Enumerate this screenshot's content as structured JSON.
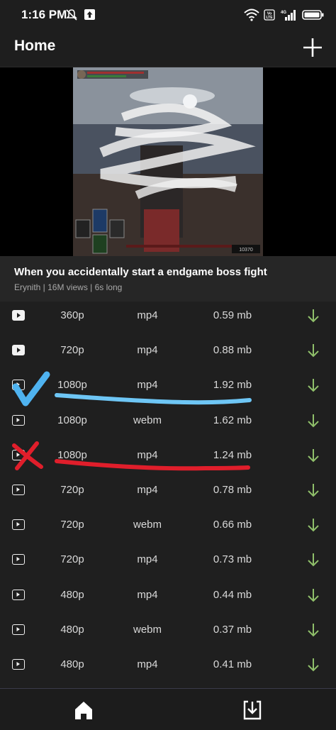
{
  "status_bar": {
    "time": "1:16 PM",
    "left_icons": [
      "mute-icon",
      "upload-icon"
    ],
    "right_icons": [
      "wifi-icon",
      "volte-icon",
      "4g-signal-icon",
      "battery-icon"
    ]
  },
  "app_bar": {
    "title": "Home",
    "add_icon": "plus-icon"
  },
  "video": {
    "title": "When you accidentally start a endgame boss fight",
    "meta": "Erynith | 16M views | 6s long",
    "thumbnail_hud_text": "10370"
  },
  "formats": [
    {
      "resolution": "360p",
      "format": "mp4",
      "size": "0.59 mb",
      "icon": "filled"
    },
    {
      "resolution": "720p",
      "format": "mp4",
      "size": "0.88 mb",
      "icon": "filled"
    },
    {
      "resolution": "1080p",
      "format": "mp4",
      "size": "1.92 mb",
      "icon": "outline"
    },
    {
      "resolution": "1080p",
      "format": "webm",
      "size": "1.62 mb",
      "icon": "outline"
    },
    {
      "resolution": "1080p",
      "format": "mp4",
      "size": "1.24 mb",
      "icon": "outline"
    },
    {
      "resolution": "720p",
      "format": "mp4",
      "size": "0.78 mb",
      "icon": "outline"
    },
    {
      "resolution": "720p",
      "format": "webm",
      "size": "0.66 mb",
      "icon": "outline"
    },
    {
      "resolution": "720p",
      "format": "mp4",
      "size": "0.73 mb",
      "icon": "outline"
    },
    {
      "resolution": "480p",
      "format": "mp4",
      "size": "0.44 mb",
      "icon": "outline"
    },
    {
      "resolution": "480p",
      "format": "webm",
      "size": "0.37 mb",
      "icon": "outline"
    },
    {
      "resolution": "480p",
      "format": "mp4",
      "size": "0.41 mb",
      "icon": "outline"
    }
  ],
  "bottom_nav": {
    "items": [
      "home-icon",
      "downloads-icon"
    ]
  },
  "colors": {
    "background": "#1f1f1f",
    "download_arrow": "#8fbf6a",
    "check_mark": "#4fb3f0",
    "blue_underline": "#6ec6f5",
    "red_mark": "#e01e2b"
  }
}
